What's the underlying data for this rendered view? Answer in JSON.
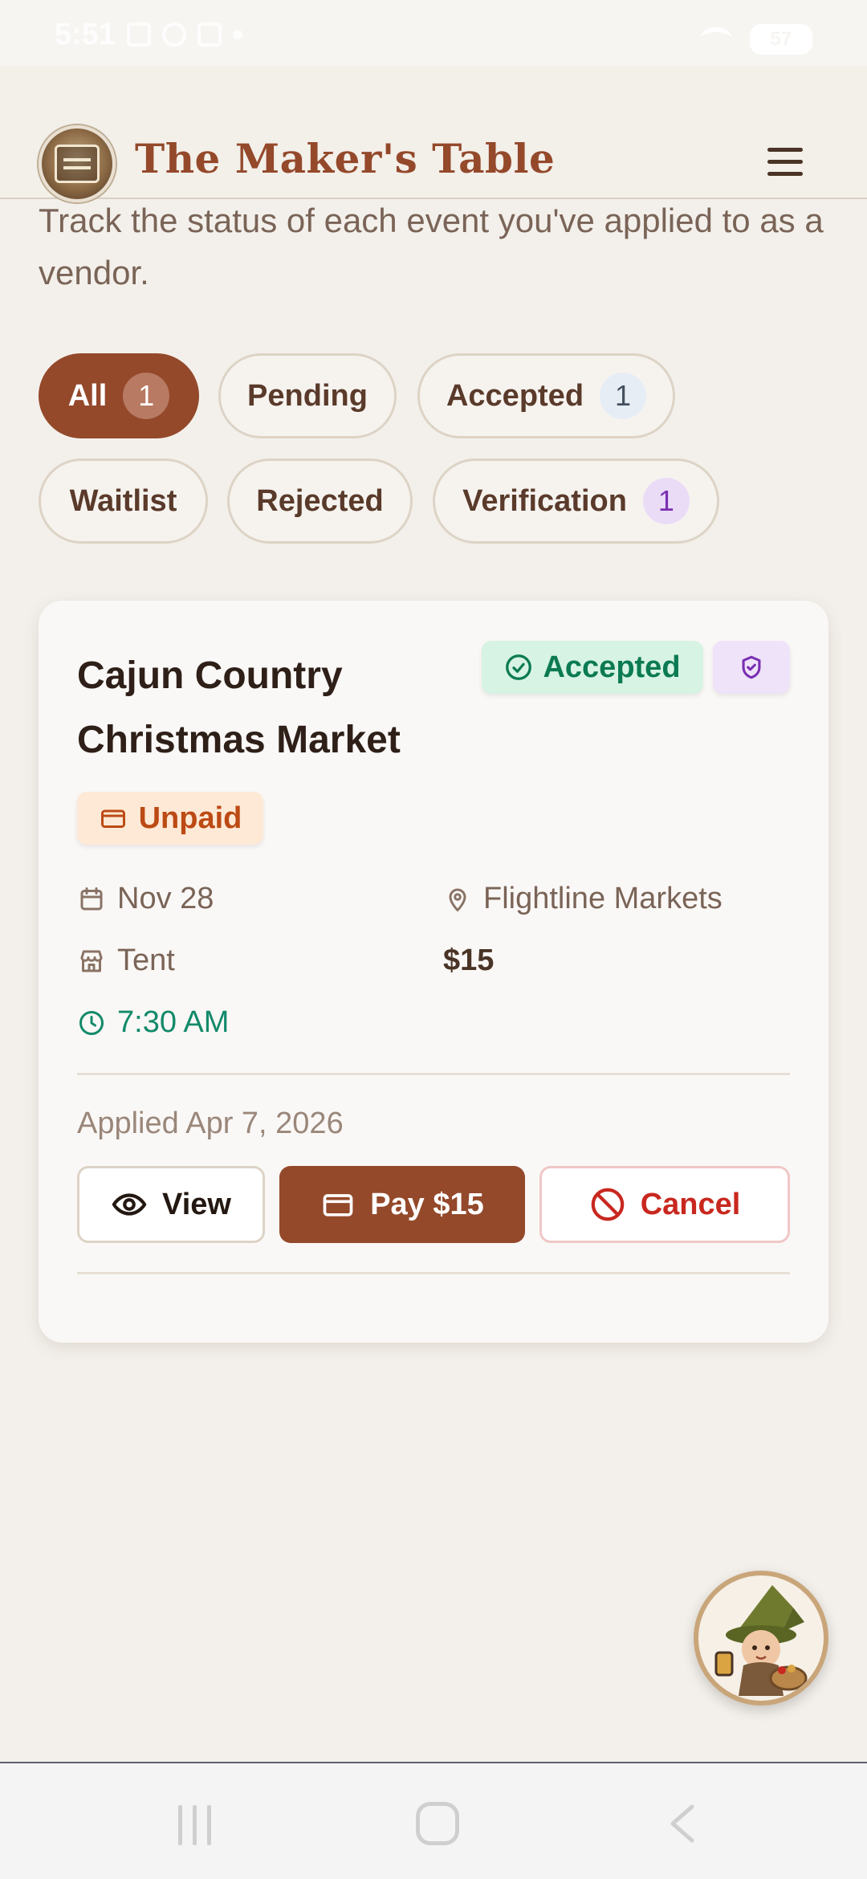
{
  "status_bar": {
    "time": "5:51",
    "battery": "57"
  },
  "header": {
    "title": "The Maker's Table",
    "logo_icon": "makers-table-logo",
    "menu_icon": "hamburger-menu-icon"
  },
  "page": {
    "description": "Track the status of each event you've applied to as a vendor."
  },
  "filters": [
    {
      "label": "All",
      "count": "1",
      "active": true
    },
    {
      "label": "Pending",
      "count": null
    },
    {
      "label": "Accepted",
      "count": "1"
    },
    {
      "label": "Waitlist",
      "count": null
    },
    {
      "label": "Rejected",
      "count": null
    },
    {
      "label": "Verification",
      "count": "1"
    }
  ],
  "card": {
    "title": "Cajun Country Christmas Market",
    "status_badge": "Accepted",
    "payment_badge": "Unpaid",
    "date": "Nov 28",
    "location": "Flightline Markets",
    "spot_type": "Tent",
    "price": "$15",
    "time": "7:30 AM",
    "applied": "Applied Apr 7, 2026",
    "actions": {
      "view": "View",
      "pay": "Pay $15",
      "cancel": "Cancel"
    }
  },
  "colors": {
    "brand": "#94492b",
    "accepted": "#0b7a52",
    "unpaid": "#bc4a14",
    "cancel": "#c8281f",
    "verification": "#7a2fb2"
  }
}
